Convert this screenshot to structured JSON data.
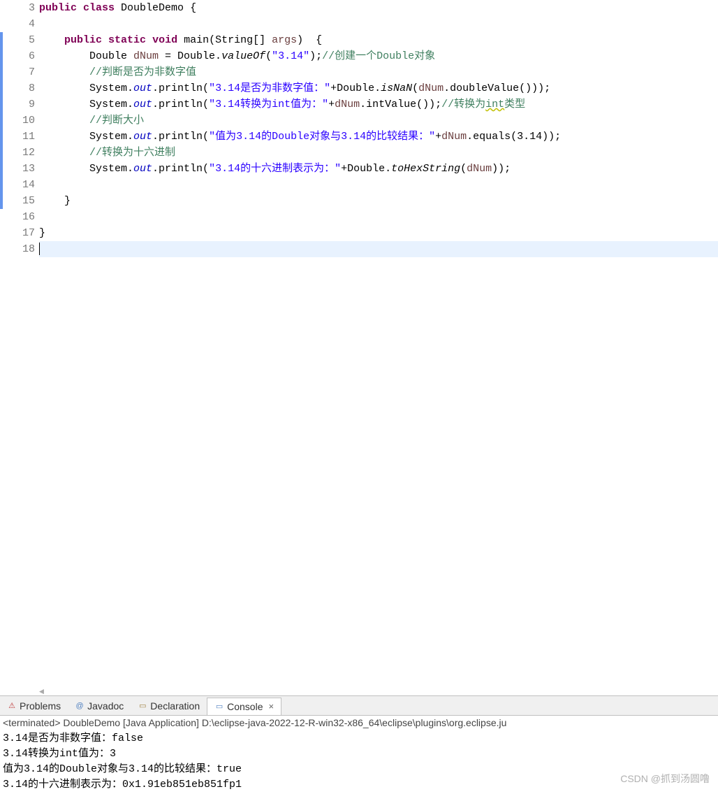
{
  "editor": {
    "lineNumbers": [
      "3",
      "4",
      "5",
      "6",
      "7",
      "8",
      "9",
      "10",
      "11",
      "12",
      "13",
      "14",
      "15",
      "16",
      "17",
      "18"
    ],
    "lines": {
      "3": {
        "tokens": [
          {
            "cls": "kw",
            "t": "public"
          },
          {
            "cls": "",
            "t": " "
          },
          {
            "cls": "kw",
            "t": "class"
          },
          {
            "cls": "",
            "t": " DoubleDemo {"
          }
        ]
      },
      "4": {
        "tokens": []
      },
      "5": {
        "tokens": [
          {
            "cls": "",
            "t": "    "
          },
          {
            "cls": "kw",
            "t": "public"
          },
          {
            "cls": "",
            "t": " "
          },
          {
            "cls": "kw",
            "t": "static"
          },
          {
            "cls": "",
            "t": " "
          },
          {
            "cls": "kw",
            "t": "void"
          },
          {
            "cls": "",
            "t": " main(String[] "
          },
          {
            "cls": "param",
            "t": "args"
          },
          {
            "cls": "",
            "t": ")  {"
          }
        ]
      },
      "6": {
        "tokens": [
          {
            "cls": "",
            "t": "        Double "
          },
          {
            "cls": "local-var",
            "t": "dNum"
          },
          {
            "cls": "",
            "t": " = Double."
          },
          {
            "cls": "static-method",
            "t": "valueOf"
          },
          {
            "cls": "",
            "t": "("
          },
          {
            "cls": "str",
            "t": "\"3.14\""
          },
          {
            "cls": "",
            "t": ");"
          },
          {
            "cls": "cmt",
            "t": "//创建一个Double对象"
          }
        ]
      },
      "7": {
        "tokens": [
          {
            "cls": "",
            "t": "        "
          },
          {
            "cls": "cmt",
            "t": "//判断是否为非数字值"
          }
        ]
      },
      "8": {
        "tokens": [
          {
            "cls": "",
            "t": "        System."
          },
          {
            "cls": "static-field",
            "t": "out"
          },
          {
            "cls": "",
            "t": ".println("
          },
          {
            "cls": "str",
            "t": "\"3.14是否为非数字值：\""
          },
          {
            "cls": "",
            "t": "+Double."
          },
          {
            "cls": "static-method",
            "t": "isNaN"
          },
          {
            "cls": "",
            "t": "("
          },
          {
            "cls": "local-var",
            "t": "dNum"
          },
          {
            "cls": "",
            "t": ".doubleValue()));"
          }
        ]
      },
      "9": {
        "tokens": [
          {
            "cls": "",
            "t": "        System."
          },
          {
            "cls": "static-field",
            "t": "out"
          },
          {
            "cls": "",
            "t": ".println("
          },
          {
            "cls": "str",
            "t": "\"3.14转换为int值为：\""
          },
          {
            "cls": "",
            "t": "+"
          },
          {
            "cls": "local-var",
            "t": "dNum"
          },
          {
            "cls": "",
            "t": ".intValue());"
          },
          {
            "cls": "cmt",
            "t": "//转换为"
          },
          {
            "cls": "cmt underline-warn",
            "t": "int"
          },
          {
            "cls": "cmt",
            "t": "类型"
          }
        ]
      },
      "10": {
        "tokens": [
          {
            "cls": "",
            "t": "        "
          },
          {
            "cls": "cmt",
            "t": "//判断大小"
          }
        ]
      },
      "11": {
        "tokens": [
          {
            "cls": "",
            "t": "        System."
          },
          {
            "cls": "static-field",
            "t": "out"
          },
          {
            "cls": "",
            "t": ".println("
          },
          {
            "cls": "str",
            "t": "\"值为3.14的Double对象与3.14的比较结果：\""
          },
          {
            "cls": "",
            "t": "+"
          },
          {
            "cls": "local-var",
            "t": "dNum"
          },
          {
            "cls": "",
            "t": ".equals(3.14));"
          }
        ]
      },
      "12": {
        "tokens": [
          {
            "cls": "",
            "t": "        "
          },
          {
            "cls": "cmt",
            "t": "//转换为十六进制"
          }
        ]
      },
      "13": {
        "tokens": [
          {
            "cls": "",
            "t": "        System."
          },
          {
            "cls": "static-field",
            "t": "out"
          },
          {
            "cls": "",
            "t": ".println("
          },
          {
            "cls": "str",
            "t": "\"3.14的十六进制表示为：\""
          },
          {
            "cls": "",
            "t": "+Double."
          },
          {
            "cls": "static-method",
            "t": "toHexString"
          },
          {
            "cls": "",
            "t": "("
          },
          {
            "cls": "local-var",
            "t": "dNum"
          },
          {
            "cls": "",
            "t": "));"
          }
        ]
      },
      "14": {
        "tokens": []
      },
      "15": {
        "tokens": [
          {
            "cls": "",
            "t": "    }"
          }
        ]
      },
      "16": {
        "tokens": []
      },
      "17": {
        "tokens": [
          {
            "cls": "",
            "t": "}"
          }
        ]
      },
      "18": {
        "tokens": [],
        "current": true
      }
    },
    "markers": [
      {
        "start": 5,
        "end": 15
      }
    ]
  },
  "tabs": {
    "problems": "Problems",
    "javadoc": "Javadoc",
    "declaration": "Declaration",
    "console": "Console"
  },
  "console": {
    "header": "<terminated> DoubleDemo [Java Application] D:\\eclipse-java-2022-12-R-win32-x86_64\\eclipse\\plugins\\org.eclipse.ju",
    "lines": [
      "3.14是否为非数字值：false",
      "3.14转换为int值为：3",
      "值为3.14的Double对象与3.14的比较结果：true",
      "3.14的十六进制表示为：0x1.91eb851eb851fp1"
    ]
  },
  "watermark": "CSDN @抓到汤圆噜"
}
